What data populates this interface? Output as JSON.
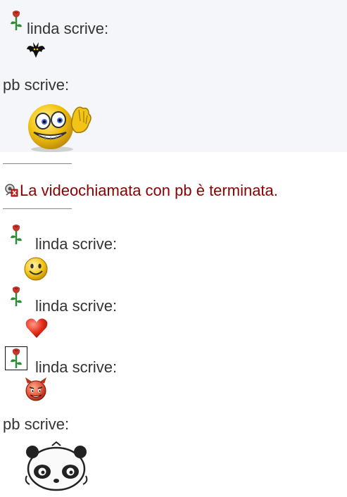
{
  "messages": [
    {
      "sender": "linda scrive:",
      "emoticon": "bat-icon"
    },
    {
      "sender": "pb scrive:",
      "emoticon": "waving-smiley-icon"
    },
    {
      "sender": "linda scrive:",
      "emoticon": "smiley-icon"
    },
    {
      "sender": "linda scrive:",
      "emoticon": "heart-icon"
    },
    {
      "sender": "linda scrive:",
      "emoticon": "devil-icon"
    },
    {
      "sender": "pb scrive:",
      "emoticon": "panda-icon"
    }
  ],
  "system_message": {
    "text": "La videochiamata con pb è terminata.",
    "color": "#8b0000",
    "icon": "video-call-ended-icon"
  },
  "colors": {
    "text": "#333333",
    "band": "#f4f6fa",
    "rose_petal": "#c0392b",
    "rose_leaf": "#2e8b3a"
  }
}
